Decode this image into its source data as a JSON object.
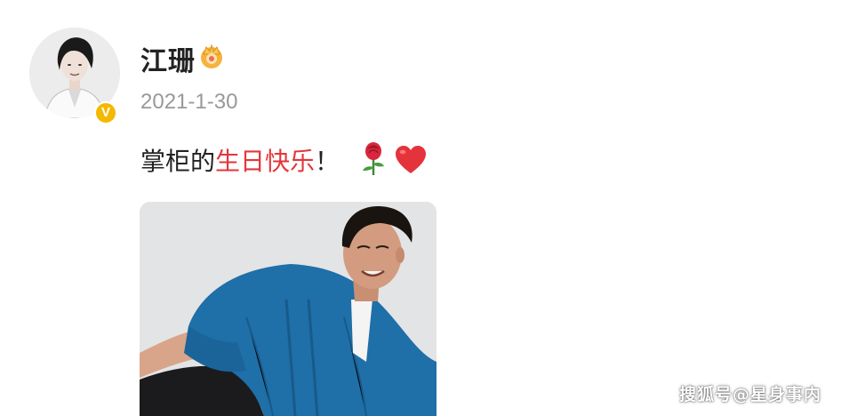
{
  "post": {
    "author": {
      "name": "江珊",
      "verified": true,
      "badge_icon": "crown-icon",
      "verified_icon": "verified-v-icon",
      "verified_glyph": "V"
    },
    "date": "2021-1-30",
    "text": {
      "prefix": "掌柜的",
      "highlight": "生日快乐",
      "suffix": "！",
      "emojis": [
        "rose-icon",
        "heart-icon"
      ]
    },
    "image": {
      "subject": "man in blue sweater photo"
    }
  },
  "watermark": "搜狐号@星身事内",
  "colors": {
    "highlight": "#e3363a",
    "date": "#999999",
    "verified_badge": "#f5b800",
    "sweater": "#1f6fa8"
  }
}
